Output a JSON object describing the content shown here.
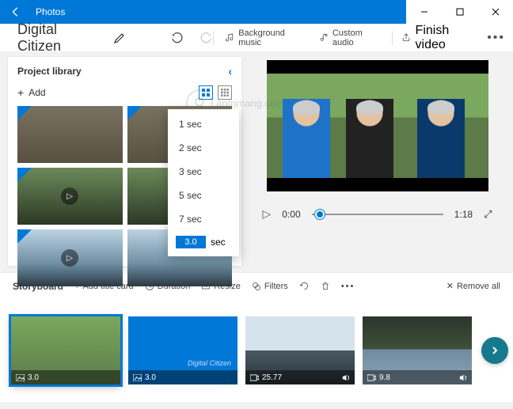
{
  "titlebar": {
    "app_name": "Photos"
  },
  "project": {
    "title": "Digital Citizen"
  },
  "toolbar": {
    "bg_music": "Background music",
    "custom_audio": "Custom audio",
    "finish": "Finish video"
  },
  "library": {
    "header": "Project library",
    "add_label": "Add"
  },
  "duration_menu": {
    "options": [
      "1 sec",
      "2 sec",
      "3 sec",
      "5 sec",
      "7 sec"
    ],
    "custom_value": "3.0",
    "custom_unit": "sec"
  },
  "transport": {
    "current": "0:00",
    "total": "1:18"
  },
  "storyboard": {
    "label": "Storyboard",
    "add_title_card": "Add title card",
    "duration": "Duration",
    "resize": "Resize",
    "filters": "Filters",
    "remove_all": "Remove all"
  },
  "clips": [
    {
      "duration": "3.0",
      "type": "photo"
    },
    {
      "duration": "3.0",
      "type": "title",
      "caption": "Digital Citizen"
    },
    {
      "duration": "25.77",
      "type": "video"
    },
    {
      "duration": "9.8",
      "type": "video"
    }
  ],
  "watermark": "antrimang.com"
}
